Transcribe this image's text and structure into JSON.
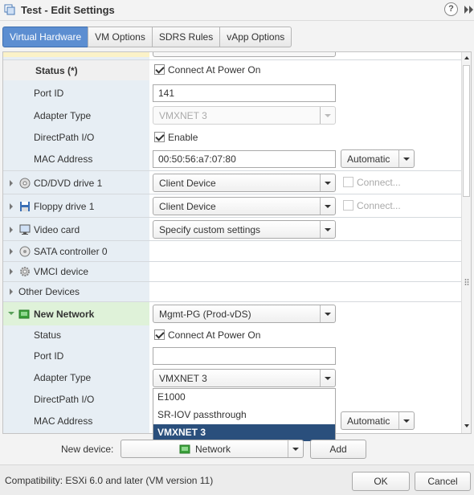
{
  "window": {
    "title": "Test - Edit Settings",
    "help_glyph": "?"
  },
  "tabs": [
    {
      "label": "Virtual Hardware",
      "active": true
    },
    {
      "label": "VM Options"
    },
    {
      "label": "SDRS Rules"
    },
    {
      "label": "vApp Options"
    }
  ],
  "rows": {
    "status1": {
      "label": "Status (*)",
      "checkbox_label": "Connect At Power On",
      "checked": true
    },
    "port_id1": {
      "label": "Port ID",
      "value": "141"
    },
    "adapter1": {
      "label": "Adapter Type",
      "value": "VMXNET 3"
    },
    "directpath1": {
      "label": "DirectPath I/O",
      "checkbox_label": "Enable",
      "checked": true
    },
    "mac1": {
      "label": "MAC Address",
      "value": "00:50:56:a7:07:80",
      "mode": "Automatic"
    },
    "cddvd": {
      "label": "CD/DVD drive 1",
      "value": "Client Device",
      "connect_label": "Connect..."
    },
    "floppy": {
      "label": "Floppy drive 1",
      "value": "Client Device",
      "connect_label": "Connect..."
    },
    "video": {
      "label": "Video card",
      "value": "Specify custom settings"
    },
    "sata": {
      "label": "SATA controller 0"
    },
    "vmci": {
      "label": "VMCI device"
    },
    "other": {
      "label": "Other Devices"
    },
    "new_network": {
      "label": "New Network",
      "value": "Mgmt-PG (Prod-vDS)"
    },
    "status2": {
      "label": "Status",
      "checkbox_label": "Connect At Power On",
      "checked": true
    },
    "port_id2": {
      "label": "Port ID",
      "value": ""
    },
    "adapter2": {
      "label": "Adapter Type",
      "value": "VMXNET 3"
    },
    "directpath2": {
      "label": "DirectPath I/O"
    },
    "mac2": {
      "label": "MAC Address",
      "mode": "Automatic"
    }
  },
  "adapter_dropdown": {
    "options": [
      "E1000",
      "SR-IOV passthrough",
      "VMXNET 3"
    ],
    "highlighted": "VMXNET 3"
  },
  "new_device": {
    "label": "New device:",
    "value": "Network",
    "add_label": "Add"
  },
  "footer": {
    "compatibility": "Compatibility: ESXi 6.0 and later (VM version 11)",
    "ok_label": "OK",
    "cancel_label": "Cancel"
  },
  "colors": {
    "accent": "#5c8ed1",
    "highlight": "#2a4f7c",
    "label_column": "#e7eef4",
    "selected_row": "#dff2d9"
  }
}
